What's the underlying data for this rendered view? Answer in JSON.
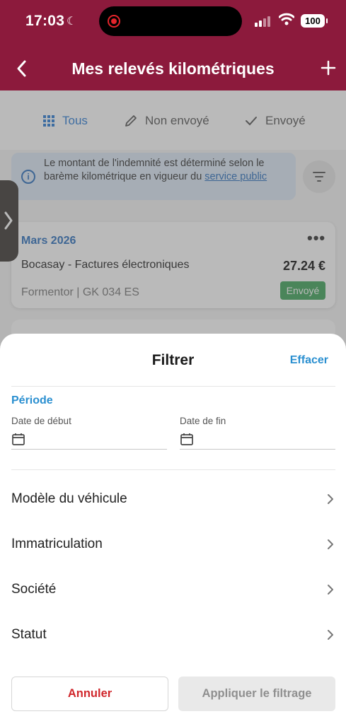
{
  "status_bar": {
    "time": "17:03",
    "battery": "100"
  },
  "header": {
    "title": "Mes relevés kilométriques"
  },
  "tabs": [
    {
      "label": "Tous",
      "icon": "grid-icon",
      "active": true
    },
    {
      "label": "Non envoyé",
      "icon": "pencil-icon",
      "active": false
    },
    {
      "label": "Envoyé",
      "icon": "check-icon",
      "active": false
    }
  ],
  "info": {
    "text": "Le montant de l'indemnité est déterminé selon le barème kilométrique en vigueur du ",
    "link": "service public"
  },
  "card": {
    "month": "Mars 2026",
    "company": "Bocasay - Factures électroniques",
    "amount": "27.24 €",
    "vehicle": "Formentor | GK 034 ES",
    "status": "Envoyé"
  },
  "sheet": {
    "title": "Filtrer",
    "clear": "Effacer",
    "period_title": "Période",
    "start_label": "Date de début",
    "end_label": "Date de fin",
    "rows": [
      {
        "label": "Modèle du véhicule"
      },
      {
        "label": "Immatriculation"
      },
      {
        "label": "Société"
      },
      {
        "label": "Statut"
      }
    ],
    "cancel": "Annuler",
    "apply": "Appliquer le filtrage"
  },
  "colors": {
    "brand": "#8c1a3c",
    "accent": "#2a8fd0",
    "danger": "#d0262b",
    "success": "#3fa45a"
  }
}
